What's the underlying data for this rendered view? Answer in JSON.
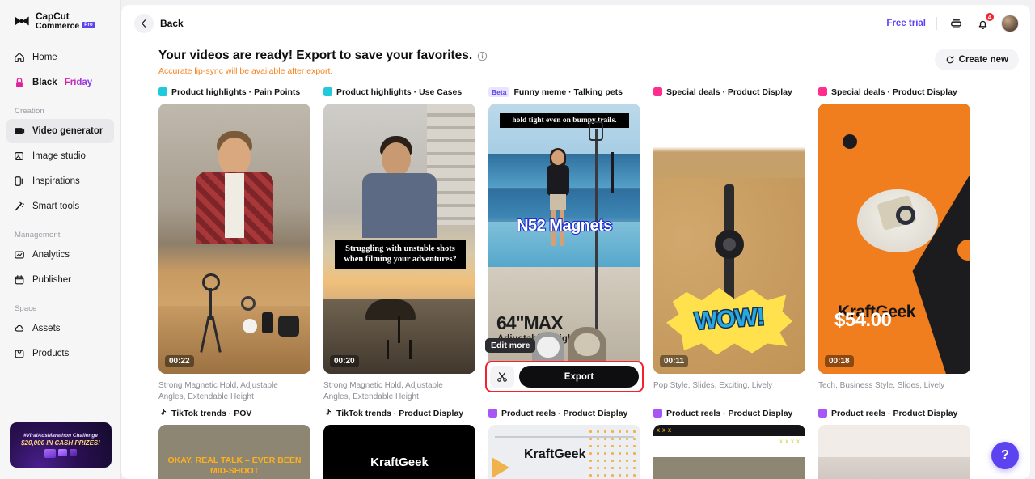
{
  "sidebar": {
    "brand": {
      "line1": "CapCut",
      "line2": "Commerce",
      "badge": "Pro"
    },
    "items": [
      {
        "label": "Home",
        "icon": "home-icon"
      },
      {
        "label": "Black ",
        "label2": "Friday",
        "icon": "lock-icon"
      }
    ],
    "sections": [
      {
        "title": "Creation",
        "items": [
          {
            "label": "Video generator",
            "icon": "video-icon",
            "active": true
          },
          {
            "label": "Image studio",
            "icon": "image-icon"
          },
          {
            "label": "Inspirations",
            "icon": "phone-icon"
          },
          {
            "label": "Smart tools",
            "icon": "wand-icon"
          }
        ]
      },
      {
        "title": "Management",
        "items": [
          {
            "label": "Analytics",
            "icon": "analytics-icon"
          },
          {
            "label": "Publisher",
            "icon": "calendar-icon"
          }
        ]
      },
      {
        "title": "Space",
        "items": [
          {
            "label": "Assets",
            "icon": "cloud-icon"
          },
          {
            "label": "Products",
            "icon": "bag-icon"
          }
        ]
      }
    ],
    "promo": {
      "line1": "#ViralAdsMarathon Challenge",
      "line2": "$20,000 IN CASH PRIZES!"
    }
  },
  "topbar": {
    "back_label": "Back",
    "free_trial": "Free trial",
    "notification_count": "4"
  },
  "header": {
    "headline": "Your videos are ready! Export to save your favorites.",
    "subline": "Accurate lip-sync will be available after export.",
    "create_new": "Create new"
  },
  "overlay": {
    "tooltip": "Edit more",
    "export_label": "Export"
  },
  "help": {
    "label": "?"
  },
  "cards": [
    {
      "tag_type": "icon",
      "tag_color": "#22c9dd",
      "title": "Product highlights · Pain Points",
      "duration": "00:22",
      "caption": "Strong Magnetic Hold, Adjustable Angles, Extendable Height",
      "overlay_text": ""
    },
    {
      "tag_type": "icon",
      "tag_color": "#22c9dd",
      "title": "Product highlights · Use Cases",
      "duration": "00:20",
      "caption": "Strong Magnetic Hold, Adjustable Angles, Extendable Height",
      "overlay_text": "Struggling with unstable shots when filming your adventures?"
    },
    {
      "tag_type": "beta",
      "tag_label": "Beta",
      "title": "Funny meme · Talking pets",
      "duration": "",
      "caption": "",
      "overlay_top": "hold tight even on bumpy trails.",
      "overlay_mid": "N52 Magnets",
      "overlay_big": "64\"MAX",
      "overlay_sub": "Adjustable Height"
    },
    {
      "tag_type": "icon",
      "tag_color": "#ff2d8e",
      "title": "Special deals · Product Display",
      "duration": "00:11",
      "caption": "Pop Style, Slides, Exciting, Lively",
      "overlay_text": "WOW!"
    },
    {
      "tag_type": "icon",
      "tag_color": "#ff2d8e",
      "title": "Special deals · Product Display",
      "duration": "00:18",
      "caption": "Tech, Business Style, Slides, Lively",
      "brand": "KraftGeek",
      "price": "$54.00"
    }
  ],
  "cards_row2": [
    {
      "tag_type": "tiktok",
      "title": "TikTok trends · POV",
      "overlay_text": "OKAY, REAL TALK – EVER BEEN MID-SHOOT"
    },
    {
      "tag_type": "tiktok",
      "title": "TikTok trends · Product Display",
      "overlay_text": "KraftGeek"
    },
    {
      "tag_type": "icon",
      "tag_color": "#a855f7",
      "title": "Product reels · Product Display",
      "overlay_text": "KraftGeek"
    },
    {
      "tag_type": "icon",
      "tag_color": "#a855f7",
      "title": "Product reels · Product Display",
      "overlay_text": ""
    },
    {
      "tag_type": "icon",
      "tag_color": "#a855f7",
      "title": "Product reels · Product Display",
      "overlay_text": ""
    }
  ]
}
